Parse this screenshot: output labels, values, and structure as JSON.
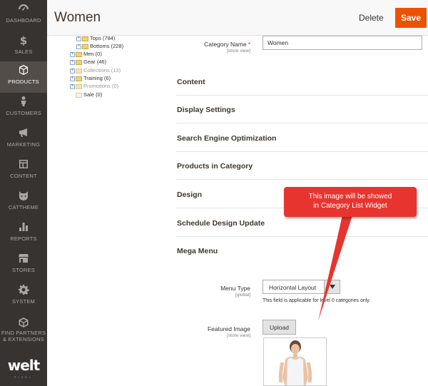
{
  "sidebar": {
    "items": [
      {
        "label": "DASHBOARD",
        "icon": "dashboard-icon"
      },
      {
        "label": "SALES",
        "icon": "dollar-icon"
      },
      {
        "label": "PRODUCTS",
        "icon": "cube-icon",
        "active": true
      },
      {
        "label": "CUSTOMERS",
        "icon": "person-icon"
      },
      {
        "label": "MARKETING",
        "icon": "megaphone-icon"
      },
      {
        "label": "CONTENT",
        "icon": "layout-icon"
      },
      {
        "label": "CATTHEME",
        "icon": "cat-icon"
      },
      {
        "label": "REPORTS",
        "icon": "bar-chart-icon"
      },
      {
        "label": "STORES",
        "icon": "storefront-icon"
      },
      {
        "label": "SYSTEM",
        "icon": "gear-icon"
      },
      {
        "label": "FIND PARTNERS\n& EXTENSIONS",
        "label1": "FIND PARTNERS",
        "label2": "& EXTENSIONS",
        "icon": "partners-icon"
      }
    ],
    "logo": "welt",
    "logo_sub": "PIXEL"
  },
  "header": {
    "title": "Women",
    "delete_label": "Delete",
    "save_label": "Save"
  },
  "tree": {
    "items": [
      {
        "label": "Tops (784)",
        "muted": false
      },
      {
        "label": "Bottoms (228)",
        "muted": false
      },
      {
        "label": "Men (0)",
        "muted": false
      },
      {
        "label": "Gear (46)",
        "muted": false
      },
      {
        "label": "Collections (13)",
        "muted": true
      },
      {
        "label": "Training (6)",
        "muted": false
      },
      {
        "label": "Promotions (0)",
        "muted": true
      },
      {
        "label": "Sale (0)",
        "muted": false
      }
    ]
  },
  "form": {
    "category_name": {
      "label": "Category Name",
      "scope": "[store view]",
      "value": "Women"
    },
    "sections": [
      "Content",
      "Display Settings",
      "Search Engine Optimization",
      "Products in Category",
      "Design",
      "Schedule Design Update",
      "Mega Menu"
    ],
    "menu_type": {
      "label": "Menu Type",
      "scope": "[global]",
      "value": "Horizontal Layout",
      "note": "This field is applicable for level 0 categories only."
    },
    "featured_image": {
      "label": "Featured Image",
      "scope": "[store view]",
      "upload_label": "Upload"
    }
  },
  "callout": {
    "line1": "This image will be showed",
    "line2": "in Category List Widget"
  },
  "colors": {
    "sidebar_bg": "#373330",
    "accent": "#eb5202",
    "callout": "#e8342f"
  }
}
